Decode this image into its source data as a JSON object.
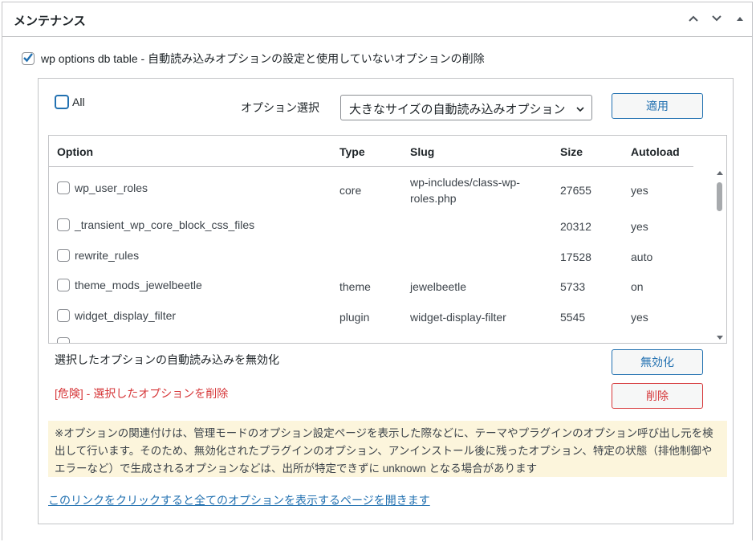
{
  "panel": {
    "title": "メンテナンス",
    "header_buttons": [
      "chevron-up",
      "chevron-down",
      "triangle-up"
    ]
  },
  "main_checkbox": {
    "checked": true,
    "label": "wp options db table - 自動読み込みオプションの設定と使用していないオプションの削除"
  },
  "controls": {
    "all_label": "All",
    "select_label": "オプション選択",
    "select_value": "大きなサイズの自動読み込みオプション",
    "apply_button": "適用"
  },
  "table": {
    "headers": {
      "option": "Option",
      "type": "Type",
      "slug": "Slug",
      "size": "Size",
      "autoload": "Autoload"
    },
    "rows": [
      {
        "option": "wp_user_roles",
        "type": "core",
        "slug": "wp-includes/class-wp-roles.php",
        "size": "27655",
        "autoload": "yes"
      },
      {
        "option": "_transient_wp_core_block_css_files",
        "type": "",
        "slug": "",
        "size": "20312",
        "autoload": "yes"
      },
      {
        "option": "rewrite_rules",
        "type": "",
        "slug": "",
        "size": "17528",
        "autoload": "auto"
      },
      {
        "option": "theme_mods_jewelbeetle",
        "type": "theme",
        "slug": "jewelbeetle",
        "size": "5733",
        "autoload": "on"
      },
      {
        "option": "widget_display_filter",
        "type": "plugin",
        "slug": "widget-display-filter",
        "size": "5545",
        "autoload": "yes"
      }
    ]
  },
  "actions": {
    "disable_text": "選択したオプションの自動読み込みを無効化",
    "disable_button": "無効化",
    "danger_text": "[危険] - 選択したオプションを削除",
    "delete_button": "削除"
  },
  "notice": "※オプションの関連付けは、管理モードのオプション設定ページを表示した際などに、テーマやプラグインのオプション呼び出し元を検出して行います。そのため、無効化されたプラグインのオプション、アンインストール後に残ったオプション、特定の状態（排他制御やエラーなど）で生成されるオプションなどは、出所が特定できずに unknown となる場合があります",
  "link": "このリンクをクリックすると全てのオプションを表示するページを開きます",
  "colors": {
    "accent": "#2271b1",
    "danger": "#d63638",
    "notice_bg": "#fcf5dc",
    "border": "#c3c4c7"
  }
}
